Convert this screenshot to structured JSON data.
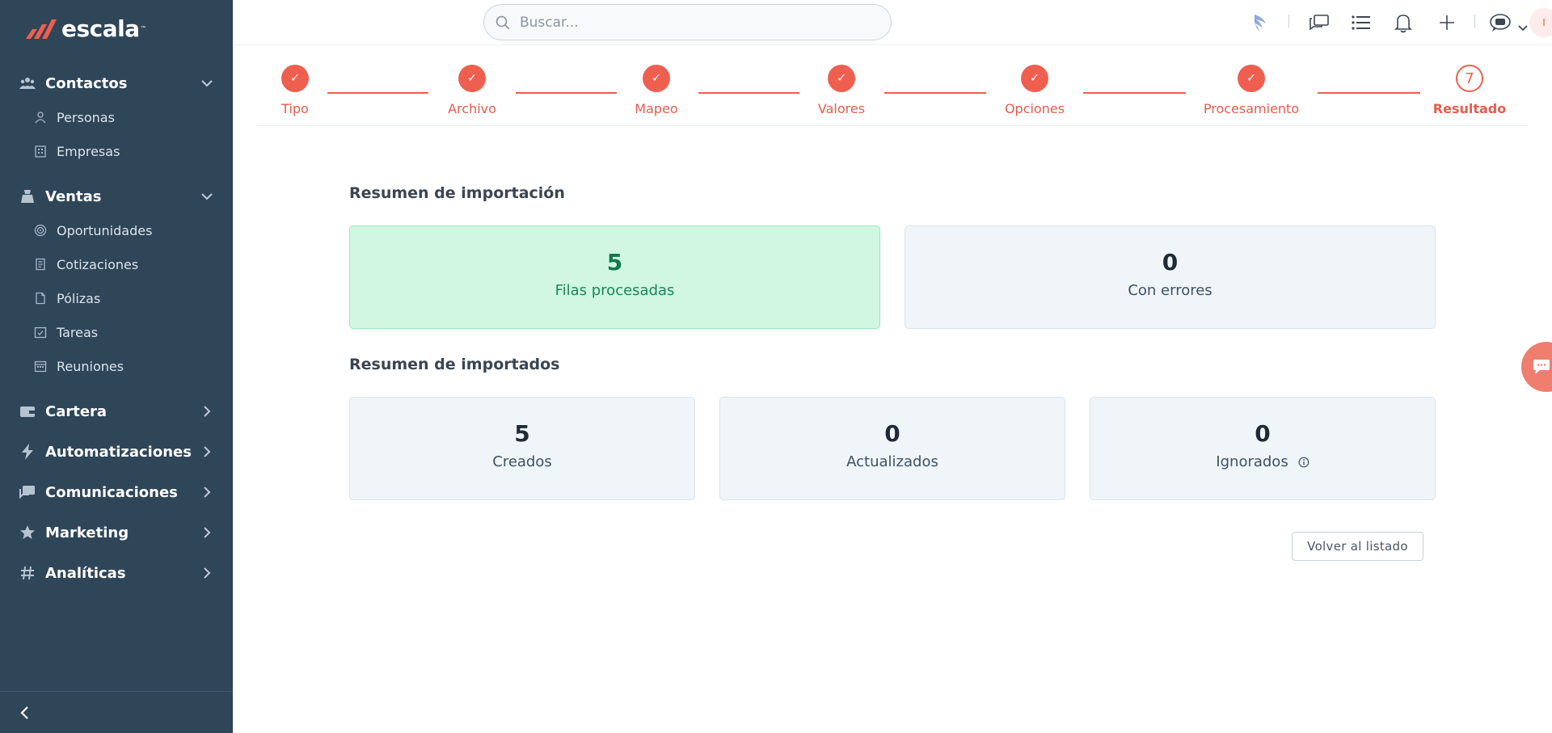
{
  "brand": {
    "name": "escala",
    "tm": "™",
    "color": "#ef5f50"
  },
  "sidebar": {
    "sections": [
      {
        "id": "contactos",
        "label": "Contactos",
        "icon": "users-icon",
        "expanded": true,
        "items": [
          {
            "label": "Personas",
            "icon": "person-icon"
          },
          {
            "label": "Empresas",
            "icon": "building-icon"
          }
        ]
      },
      {
        "id": "ventas",
        "label": "Ventas",
        "icon": "sales-icon",
        "expanded": true,
        "items": [
          {
            "label": "Oportunidades",
            "icon": "target-icon"
          },
          {
            "label": "Cotizaciones",
            "icon": "document-icon"
          },
          {
            "label": "Pólizas",
            "icon": "file-icon"
          },
          {
            "label": "Tareas",
            "icon": "calendar-check-icon"
          },
          {
            "label": "Reuniones",
            "icon": "calendar-icon"
          }
        ]
      },
      {
        "id": "cartera",
        "label": "Cartera",
        "icon": "wallet-icon",
        "expanded": false,
        "items": []
      },
      {
        "id": "automatizaciones",
        "label": "Automatizaciones",
        "icon": "lightning-icon",
        "expanded": false,
        "items": []
      },
      {
        "id": "comunicaciones",
        "label": "Comunicaciones",
        "icon": "chat-icon",
        "expanded": false,
        "items": []
      },
      {
        "id": "marketing",
        "label": "Marketing",
        "icon": "star-icon",
        "expanded": false,
        "items": []
      },
      {
        "id": "analiticas",
        "label": "Analíticas",
        "icon": "hash-icon",
        "expanded": false,
        "items": []
      }
    ]
  },
  "search": {
    "placeholder": "Buscar..."
  },
  "avatar": {
    "initial": "I",
    "status_color": "#48c9a0"
  },
  "stepper": {
    "steps": [
      {
        "label": "Tipo",
        "state": "done",
        "mark": "✓"
      },
      {
        "label": "Archivo",
        "state": "done",
        "mark": "✓"
      },
      {
        "label": "Mapeo",
        "state": "done",
        "mark": "✓"
      },
      {
        "label": "Valores",
        "state": "done",
        "mark": "✓"
      },
      {
        "label": "Opciones",
        "state": "done",
        "mark": "✓"
      },
      {
        "label": "Procesamiento",
        "state": "done",
        "mark": "✓"
      },
      {
        "label": "Resultado",
        "state": "current",
        "mark": "7"
      }
    ]
  },
  "import_summary": {
    "title": "Resumen de importación",
    "processed": {
      "value": "5",
      "label": "Filas procesadas"
    },
    "errors": {
      "value": "0",
      "label": "Con errores"
    }
  },
  "imported_summary": {
    "title": "Resumen de importados",
    "created": {
      "value": "5",
      "label": "Creados"
    },
    "updated": {
      "value": "0",
      "label": "Actualizados"
    },
    "ignored": {
      "value": "0",
      "label": "Ignorados"
    }
  },
  "actions": {
    "back_label": "Volver al listado"
  }
}
